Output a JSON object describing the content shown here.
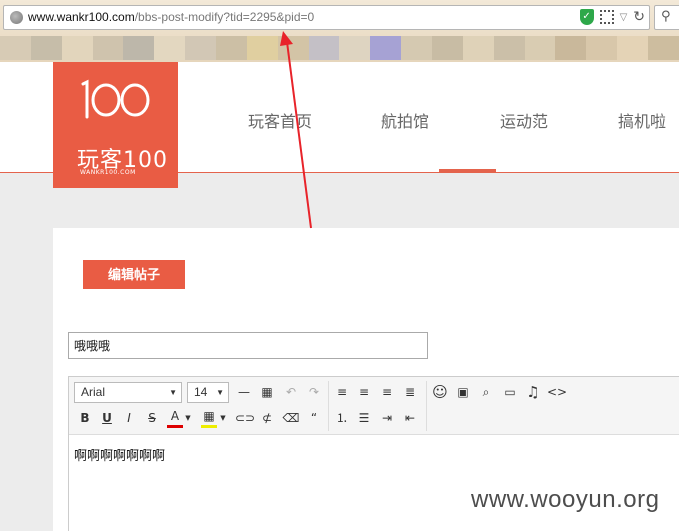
{
  "browser": {
    "url_domain": "www.wankr100.com",
    "url_path": "/bbs-post-modify?tid=2295&pid=0"
  },
  "logo": {
    "text": "玩客100",
    "subtext": "WANKR100.COM",
    "mark": "100"
  },
  "nav": {
    "items": [
      {
        "label": "玩客首页"
      },
      {
        "label": "航拍馆"
      },
      {
        "label": "运动范"
      },
      {
        "label": "搞机啦"
      }
    ],
    "active_index": 2
  },
  "page": {
    "edit_button_label": "编辑帖子",
    "title_value": "哦哦哦"
  },
  "editor": {
    "font_family": "Arial",
    "font_size": "14",
    "content": "啊啊啊啊啊啊啊"
  },
  "watermark": "www.wooyun.org",
  "colors": {
    "accent": "#e95c44",
    "active_nav_line": "#e4634c",
    "annotation_arrow": "#e8232a"
  }
}
